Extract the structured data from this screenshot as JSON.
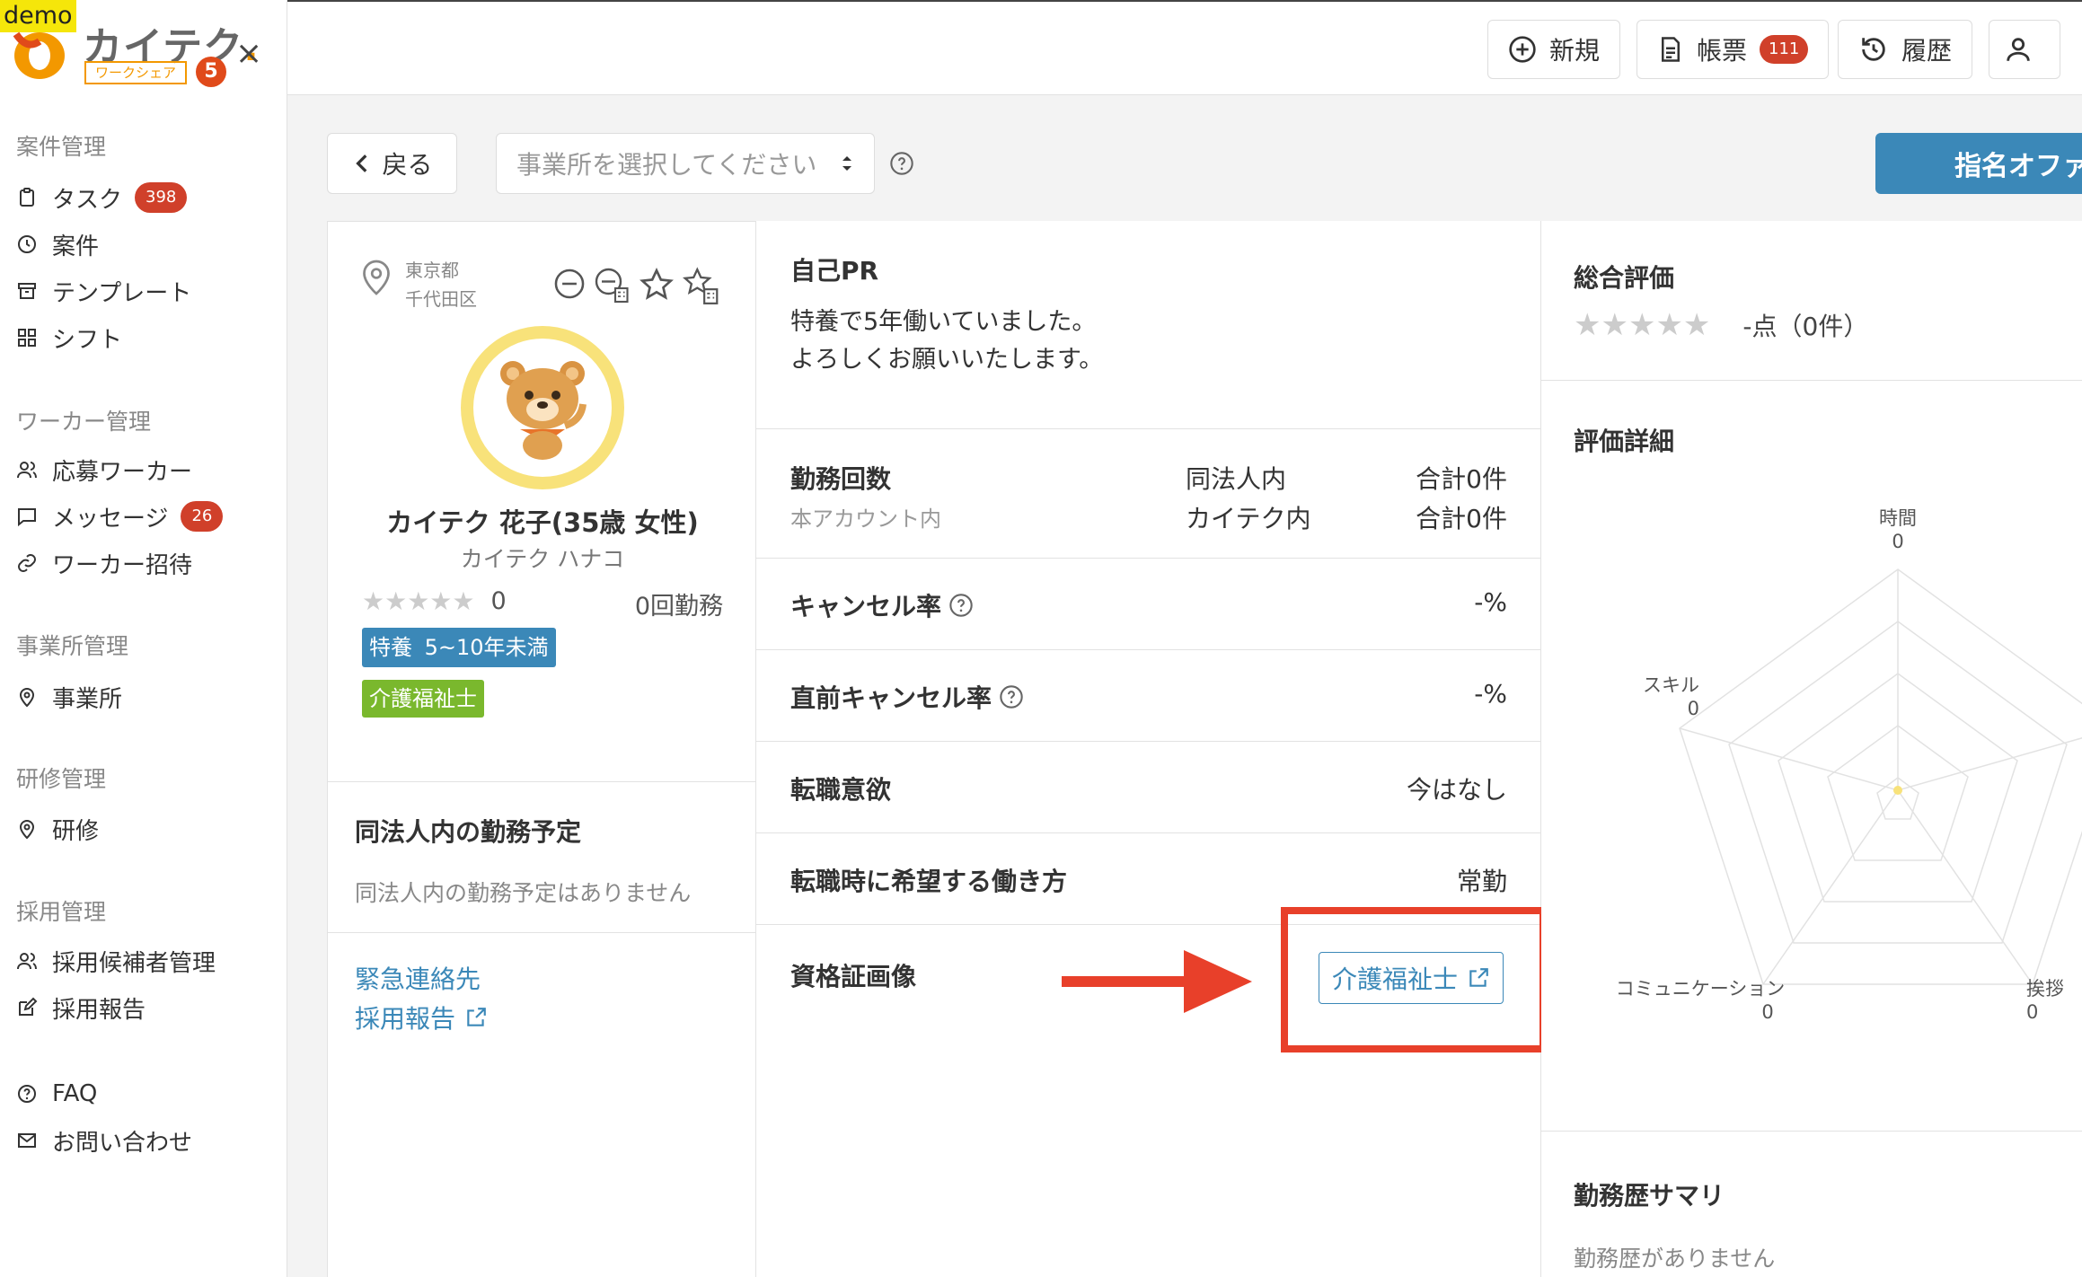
{
  "app": {
    "demo_label": "demo",
    "logo_text": "カイテク",
    "logo_dot": ".",
    "logo_sub": "ワークシェア",
    "logo_badge": "5",
    "close_symbol": "×"
  },
  "sidebar": {
    "sections": [
      {
        "title": "案件管理"
      },
      {
        "title": "ワーカー管理"
      },
      {
        "title": "事業所管理"
      },
      {
        "title": "研修管理"
      },
      {
        "title": "採用管理"
      }
    ],
    "items": {
      "task": {
        "label": "タスク",
        "badge": "398",
        "icon": "clipboard-icon"
      },
      "project": {
        "label": "案件",
        "icon": "clock-icon"
      },
      "template": {
        "label": "テンプレート",
        "icon": "archive-icon"
      },
      "shift": {
        "label": "シフト",
        "icon": "grid-icon"
      },
      "applicants": {
        "label": "応募ワーカー",
        "icon": "users-icon"
      },
      "messages": {
        "label": "メッセージ",
        "badge": "26",
        "icon": "chat-icon"
      },
      "invite": {
        "label": "ワーカー招待",
        "icon": "link-icon"
      },
      "office": {
        "label": "事業所",
        "icon": "location-icon"
      },
      "training": {
        "label": "研修",
        "icon": "location-icon"
      },
      "candidates": {
        "label": "採用候補者管理",
        "icon": "users-icon"
      },
      "report": {
        "label": "採用報告",
        "icon": "edit-icon"
      },
      "faq": {
        "label": "FAQ",
        "icon": "help-icon"
      },
      "contact": {
        "label": "お問い合わせ",
        "icon": "mail-icon"
      }
    }
  },
  "topbar": {
    "new_label": "新規",
    "forms_label": "帳票",
    "forms_badge": "111",
    "history_label": "履歴"
  },
  "toolbar": {
    "back_label": "戻る",
    "office_placeholder": "事業所を選択してください",
    "nominate_label": "指名オファ"
  },
  "profile": {
    "prefecture": "東京都",
    "city": "千代田区",
    "name": "カイテク 花子(35歳 女性)",
    "kana": "カイテク ハナコ",
    "rating": "0",
    "stars": "★★★★★",
    "work_count": "0回勤務",
    "tag_experience": "特養",
    "tag_experience_years": "5~10年未満",
    "tag_qualification": "介護福祉士"
  },
  "schedule": {
    "title": "同法人内の勤務予定",
    "empty": "同法人内の勤務予定はありません"
  },
  "links": {
    "emergency": "緊急連絡先",
    "report": "採用報告"
  },
  "details": {
    "pr_title": "自己PR",
    "pr_line1": "特養で5年働いていました。",
    "pr_line2": "よろしくお願いいたします。",
    "work_count_title": "勤務回数",
    "work_count_sub": "本アカウント内",
    "same_corp_label": "同法人内",
    "same_corp_value": "合計0件",
    "kaitek_label": "カイテク内",
    "kaitek_value": "合計0件",
    "cancel_rate_label": "キャンセル率",
    "cancel_rate_value": "-%",
    "last_cancel_label": "直前キャンセル率",
    "last_cancel_value": "-%",
    "job_change_label": "転職意欲",
    "job_change_value": "今はなし",
    "work_style_label": "転職時に希望する働き方",
    "work_style_value": "常勤",
    "cert_label": "資格証画像",
    "cert_link": "介護福祉士"
  },
  "evaluation": {
    "overall_title": "総合評価",
    "stars": "★★★★★",
    "overall_score": "-点（0件）",
    "detail_title": "評価詳細",
    "radar": [
      {
        "label": "時間",
        "value": "0"
      },
      {
        "label": "挨拶",
        "value": "0"
      },
      {
        "label": "コミュニケーション",
        "value": "0"
      },
      {
        "label": "スキル",
        "value": "0"
      }
    ],
    "history_title": "勤務歴サマリ",
    "history_empty": "勤務歴がありません"
  },
  "colors": {
    "accent": "#3b88b8",
    "badge": "#d0402a",
    "highlight": "#e8402a",
    "tag_green": "#7ab82d"
  }
}
